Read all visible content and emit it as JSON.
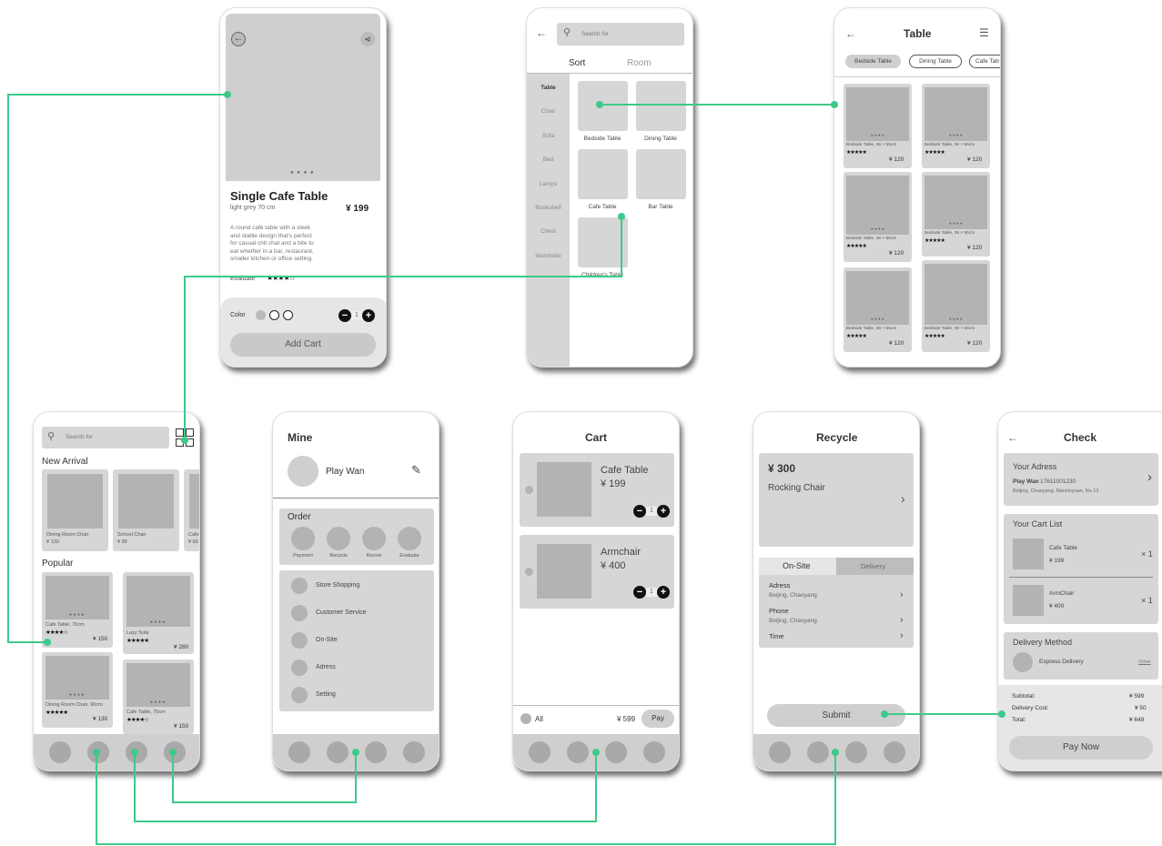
{
  "detail": {
    "title": "Single Cafe Table",
    "subtitle": "light grey 70 cm",
    "price": "¥ 199",
    "description": [
      "A round café table with a sleek",
      "and stable design that's perfect",
      "for casual chit chat and a bite to",
      "eat whether in a bar, restaurant,",
      "smaller kitchen or office setting."
    ],
    "evaluate_label": "Evaluate",
    "evaluate_stars": "★★★★☆",
    "color_label": "Color",
    "quantity": "1",
    "add_cart": "Add Cart",
    "dots": "● ● ● ●"
  },
  "sort": {
    "search_placeholder": "Search for",
    "tab_sort": "Sort",
    "tab_room": "Room",
    "categories": [
      "Table",
      "Chair",
      "Sofa",
      "Bed",
      "Lamps",
      "Bookshelf",
      "Chest",
      "Wardrobe"
    ],
    "items": [
      "Bedside Table",
      "Dining Table",
      "Cafe Table",
      "Bar Table",
      "Children's Table"
    ]
  },
  "table": {
    "title": "Table",
    "filters": [
      "Bedside Table",
      "Dining Table",
      "Cafe Tab"
    ],
    "product_name": "Bedside Table, 36 × 55cm",
    "stars": "★★★★★",
    "price": "¥ 120"
  },
  "home": {
    "search_placeholder": "Search for",
    "new_arrival": "New Arrival",
    "arrivals": [
      {
        "name": "Dining Room Chair",
        "price": "¥ 130"
      },
      {
        "name": "School Chair",
        "price": "¥ 99"
      },
      {
        "name": "Cafe",
        "price": "¥ 60"
      }
    ],
    "popular": "Popular",
    "popular_items": [
      {
        "name": "Cafe Table, 70cm",
        "stars": "★★★★☆",
        "price": "¥ 150"
      },
      {
        "name": "Lazy Sofa",
        "stars": "★★★★★",
        "price": "¥ 280"
      },
      {
        "name": "Dining Room Chair, 60cm",
        "stars": "★★★★★",
        "price": "¥ 130"
      },
      {
        "name": "Cafe Table, 70cm",
        "stars": "★★★★☆",
        "price": "¥ 150"
      }
    ]
  },
  "mine": {
    "title": "Mine",
    "user": "Play Wan",
    "order": "Order",
    "order_items": [
      "Payment",
      "Recycle",
      "Recive",
      "Evaluate"
    ],
    "menu": [
      "Store Shopping",
      "Customer Service",
      "On-Site",
      "Adress",
      "Setting"
    ]
  },
  "cart": {
    "title": "Cart",
    "items": [
      {
        "name": "Cafe Table",
        "price": "¥ 199",
        "qty": "1"
      },
      {
        "name": "Armchair",
        "price": "¥ 400",
        "qty": "1"
      }
    ],
    "all": "All",
    "total": "¥ 599",
    "pay": "Pay"
  },
  "recycle": {
    "title": "Recycle",
    "price": "¥ 300",
    "item": "Rocking Chair",
    "tab_onsite": "On-Site",
    "tab_delivery": "Delivery",
    "adress_label": "Adress",
    "adress_value": "Beijing, Chaoyang",
    "phone_label": "Phone",
    "phone_value": "Beijing, Chaoyang",
    "time_label": "Time",
    "submit": "Submit"
  },
  "check": {
    "title": "Check",
    "address_heading": "Your Adress",
    "address_name": "Play Wan",
    "address_phone": "17611001230",
    "address_line": "Beijing, Chaoyang, Nanxinyuan, No.12",
    "cart_heading": "Your Cart List",
    "items": [
      {
        "name": "Cafe Table",
        "price": "¥ 199",
        "qty": "× 1"
      },
      {
        "name": "ArmChair",
        "price": "¥ 400",
        "qty": "× 1"
      }
    ],
    "delivery_heading": "Delivery Method",
    "delivery_option": "Express Delivery",
    "delivery_other": "Other",
    "subtotal_label": "Subtotal:",
    "subtotal": "¥ 599",
    "delivery_cost_label": "Delivery Cost:",
    "delivery_cost": "¥ 50",
    "total_label": "Total:",
    "total": "¥ 649",
    "pay_now": "Pay Now"
  },
  "colors": {
    "link": "#3ec98a",
    "panel": "#d6d6d6",
    "image": "#b3b3b3",
    "nav": "#cfcfcf"
  }
}
